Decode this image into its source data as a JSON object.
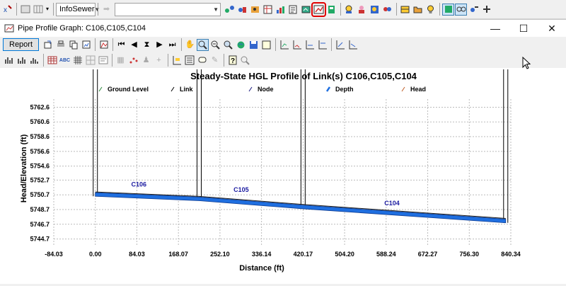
{
  "toolbar": {
    "network_combo": "InfoSewer",
    "layer_combo": ""
  },
  "window": {
    "title": "Pipe Profile Graph: C106,C105,C104",
    "minimize_glyph": "—",
    "maximize_glyph": "☐",
    "close_glyph": "✕"
  },
  "graph_toolbar": {
    "report_label": "Report"
  },
  "colors": {
    "pipe_fill": "#1f6fe0",
    "hgl_line": "#1a1a80",
    "highlight": "#e00000",
    "link_label": "#1a1aa0"
  },
  "chart_data": {
    "type": "line",
    "title": "Steady-State HGL Profile of Link(s) C106,C105,C104",
    "xlabel": "Distance (ft)",
    "ylabel": "Head/Elevation (ft)",
    "legend": [
      "Ground Level",
      "Link",
      "Node",
      "Depth",
      "Head"
    ],
    "legend_position": "top",
    "grid": true,
    "xlim": [
      -84.03,
      840.34
    ],
    "ylim": [
      5743.7,
      5763.7
    ],
    "x_ticks": [
      "-84.03",
      "0.00",
      "84.03",
      "168.07",
      "252.10",
      "336.14",
      "420.17",
      "504.20",
      "588.24",
      "672.27",
      "756.30",
      "840.34"
    ],
    "y_ticks": [
      "5762.6",
      "5760.6",
      "5758.6",
      "5756.6",
      "5754.6",
      "5752.7",
      "5750.7",
      "5748.7",
      "5746.7",
      "5744.7"
    ],
    "nodes_x": [
      0,
      210,
      420.17,
      830
    ],
    "pipe_invert": [
      {
        "x": 0,
        "y": 5750.5
      },
      {
        "x": 210,
        "y": 5749.9
      },
      {
        "x": 420.17,
        "y": 5748.8
      },
      {
        "x": 830,
        "y": 5746.9
      }
    ],
    "pipe_crown": [
      {
        "x": 0,
        "y": 5751.0
      },
      {
        "x": 210,
        "y": 5750.4
      },
      {
        "x": 420.17,
        "y": 5749.3
      },
      {
        "x": 830,
        "y": 5747.4
      }
    ],
    "links": [
      {
        "name": "C106",
        "x": 88,
        "y": 5750.85
      },
      {
        "name": "C105",
        "x": 295,
        "y": 5750.15
      },
      {
        "name": "C104",
        "x": 600,
        "y": 5748.3
      }
    ]
  }
}
